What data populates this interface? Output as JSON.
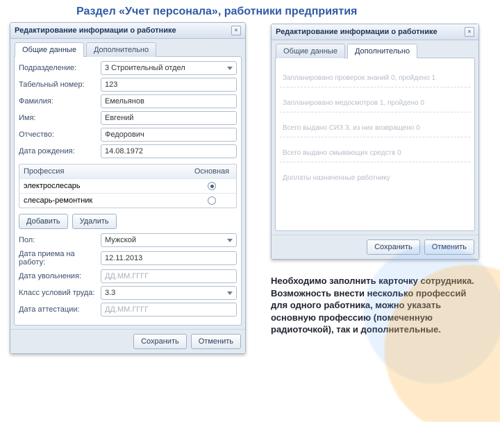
{
  "page_title": "Раздел «Учет персонала», работники предприятия",
  "dialog_title": "Редактирование информации о работнике",
  "close_glyph": "×",
  "tabs": {
    "general": "Общие данные",
    "extra": "Дополнительно"
  },
  "left": {
    "fields": {
      "dept_label": "Подразделение:",
      "dept_value": "3 Строительный отдел",
      "tabnum_label": "Табельный номер:",
      "tabnum_value": "123",
      "lastname_label": "Фамилия:",
      "lastname_value": "Емельянов",
      "firstname_label": "Имя:",
      "firstname_value": "Евгений",
      "midname_label": "Отчество:",
      "midname_value": "Федорович",
      "birth_label": "Дата рождения:",
      "birth_value": "14.08.1972",
      "sex_label": "Пол:",
      "sex_value": "Мужской",
      "hire_label": "Дата приема на работу:",
      "hire_value": "12.11.2013",
      "fire_label": "Дата увольнения:",
      "fire_placeholder": "ДД.ММ.ГГГГ",
      "class_label": "Класс условий труда:",
      "class_value": "3.3",
      "attest_label": "Дата аттестации:",
      "attest_placeholder": "ДД.ММ.ГГГГ"
    },
    "prof_grid": {
      "col_name": "Профессия",
      "col_main": "Основная",
      "rows": [
        {
          "name": "электрослесарь",
          "main": true
        },
        {
          "name": "слесарь-ремонтник",
          "main": false
        }
      ]
    },
    "btn_add": "Добавить",
    "btn_delete": "Удалить"
  },
  "right": {
    "lines": {
      "l1": "Запланировано проверок знаний 0, пройдено 1",
      "l2": "Запланировано медосмотров 1, пройдено 0",
      "l3": "Всего выдано СИЗ 3, из них возвращено 0",
      "l4": "Всего выдано смывающих средств 0",
      "l5": "Доплаты назначенные работнику"
    }
  },
  "btn_save": "Сохранить",
  "btn_cancel": "Отменить",
  "caption": "Необходимо заполнить карточку сотрудника. Возможность внести несколько профессий для одного работника, можно указать основную профессию (помеченную радиоточкой), так и дополнительные."
}
